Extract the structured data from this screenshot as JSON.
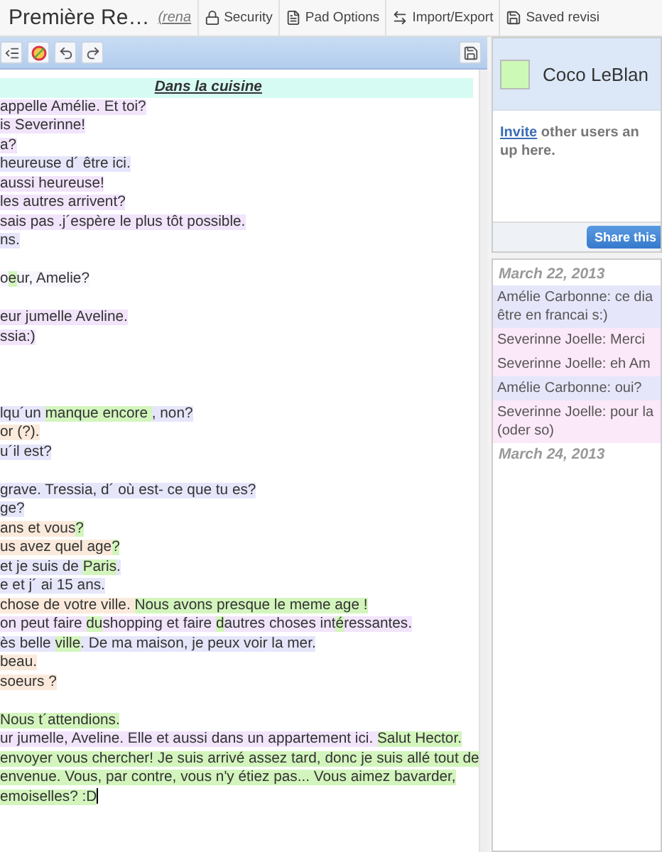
{
  "header": {
    "title": "Première Re…",
    "rename_link": "(rena"
  },
  "top_buttons": [
    {
      "kind": "lock",
      "label": "Security"
    },
    {
      "kind": "file",
      "label": "Pad Options"
    },
    {
      "kind": "arrows",
      "label": "Import/Export"
    },
    {
      "kind": "save",
      "label": "Saved revisi"
    }
  ],
  "editor": {
    "heading": "Dans la cuisine",
    "lines": [
      {
        "kind": "text",
        "segments": [
          {
            "t": "appelle Amélie. Et toi?",
            "color": "#f1e4fb"
          }
        ]
      },
      {
        "kind": "text",
        "segments": [
          {
            "t": "is Severinne!",
            "color": "#f1e4fb"
          }
        ]
      },
      {
        "kind": "text",
        "segments": [
          {
            "t": "a?",
            "color": "#f1e4fb"
          }
        ]
      },
      {
        "kind": "text",
        "segments": [
          {
            "t": "heureuse d´ être ici.",
            "color": "#e6e6fb"
          }
        ]
      },
      {
        "kind": "text",
        "segments": [
          {
            "t": "aussi heureuse!",
            "color": "#f1e4fb"
          }
        ]
      },
      {
        "kind": "text",
        "segments": [
          {
            "t": "les autres arrivent?",
            "color": "#f1e4fb"
          }
        ]
      },
      {
        "kind": "text",
        "segments": [
          {
            "t": "sais pas .j´espère le plus tôt possible.",
            "color": "#f1e4fb"
          }
        ]
      },
      {
        "kind": "text",
        "segments": [
          {
            "t": "ns.",
            "color": "#e6e6fb"
          }
        ]
      },
      {
        "kind": "blank"
      },
      {
        "kind": "text",
        "segments": [
          {
            "t": "o",
            "color": "#f6f6fd"
          },
          {
            "t": "e",
            "color": "#d3f5bd"
          },
          {
            "t": "ur, Amelie?",
            "color": "#f6f6fd"
          }
        ]
      },
      {
        "kind": "blank"
      },
      {
        "kind": "text",
        "segments": [
          {
            "t": "eur jumelle Aveline.",
            "color": "#f1e4fb"
          }
        ]
      },
      {
        "kind": "text",
        "segments": [
          {
            "t": "ssia:)",
            "color": "#f1e4fb"
          }
        ]
      },
      {
        "kind": "blank"
      },
      {
        "kind": "blank"
      },
      {
        "kind": "blank"
      },
      {
        "kind": "text",
        "segments": [
          {
            "t": "lqu´un ",
            "color": "#e6e6fb"
          },
          {
            "t": "manque encore ",
            "color": "#d3f5bd"
          },
          {
            "t": ", non?",
            "color": "#e6e6fb"
          }
        ]
      },
      {
        "kind": "text",
        "segments": [
          {
            "t": "or (?).",
            "color": "#fbeadb"
          }
        ]
      },
      {
        "kind": "text",
        "segments": [
          {
            "t": "u´il est?",
            "color": "#e6e6fb"
          }
        ]
      },
      {
        "kind": "blank"
      },
      {
        "kind": "text",
        "segments": [
          {
            "t": "grave. Tressia, d´ où est- ce que tu es?",
            "color": "#e6e6fb"
          }
        ]
      },
      {
        "kind": "text",
        "segments": [
          {
            "t": "ge?",
            "color": "#e6e6fb"
          }
        ]
      },
      {
        "kind": "text",
        "segments": [
          {
            "t": "ans et vous",
            "color": "#fbeadb"
          },
          {
            "t": "?",
            "color": "#d3f5bd"
          }
        ]
      },
      {
        "kind": "text",
        "segments": [
          {
            "t": "us avez quel age",
            "color": "#fbeadb"
          },
          {
            "t": "?",
            "color": "#d3f5bd"
          }
        ]
      },
      {
        "kind": "text",
        "segments": [
          {
            "t": "et je suis de ",
            "color": "#e6e6fb"
          },
          {
            "t": "Paris",
            "color": "#d3f5bd"
          },
          {
            "t": ".",
            "color": "#e6e6fb"
          }
        ]
      },
      {
        "kind": "text",
        "segments": [
          {
            "t": "e et j´ ai 15 ans.",
            "color": "#e6e6fb"
          }
        ]
      },
      {
        "kind": "text",
        "segments": [
          {
            "t": "chose de votre ville. ",
            "color": "#fbeadb"
          },
          {
            "t": "Nous avons presque le meme age !",
            "color": "#d3f5bd"
          }
        ]
      },
      {
        "kind": "text",
        "segments": [
          {
            "t": "on peut faire ",
            "color": "#f1e4fb"
          },
          {
            "t": "du",
            "color": "#d3f5bd"
          },
          {
            "t": "shopping et faire ",
            "color": "#f1e4fb"
          },
          {
            "t": "d",
            "color": "#d3f5bd"
          },
          {
            "t": "autres choses int",
            "color": "#f1e4fb"
          },
          {
            "t": "é",
            "color": "#d3f5bd"
          },
          {
            "t": "ressantes.",
            "color": "#f1e4fb"
          }
        ]
      },
      {
        "kind": "text",
        "segments": [
          {
            "t": "ès belle ",
            "color": "#e6e6fb"
          },
          {
            "t": "ville",
            "color": "#d3f5bd"
          },
          {
            "t": ". De ma maison, je peux voir la mer.",
            "color": "#e6e6fb"
          }
        ]
      },
      {
        "kind": "text",
        "segments": [
          {
            "t": "beau.",
            "color": "#fbeadb"
          }
        ]
      },
      {
        "kind": "text",
        "segments": [
          {
            "t": "soeurs ?",
            "color": "#fbeadb"
          }
        ]
      },
      {
        "kind": "blank"
      },
      {
        "kind": "text",
        "segments": [
          {
            "t": "Nous t´attendions.",
            "color": "#d3f5bd"
          }
        ]
      },
      {
        "kind": "text",
        "segments": [
          {
            "t": "ur jumelle, Aveline. Elle et aussi dans un appartement ici. ",
            "color": "#f1e4fb"
          },
          {
            "t": "Salut Hector.",
            "color": "#d3f5bd"
          }
        ]
      },
      {
        "kind": "text",
        "segments": [
          {
            "t": "envoyer vous chercher! Je suis arrivé assez tard, donc je suis allé tout de",
            "color": "#d3f5bd"
          }
        ]
      },
      {
        "kind": "text",
        "segments": [
          {
            "t": "envenue. Vous, par contre, vous n'y étiez pas... Vous aimez bavarder,",
            "color": "#d3f5bd"
          }
        ]
      },
      {
        "kind": "text",
        "segments": [
          {
            "t": "emoiselles? :D",
            "color": "#d3f5bd"
          }
        ]
      }
    ]
  },
  "user": {
    "name": "Coco LeBlan",
    "color": "#ccf9b5"
  },
  "invite": {
    "link": "Invite",
    "line1": "other users an",
    "line2": "up here."
  },
  "share_button": "Share this",
  "chat": [
    {
      "kind": "date",
      "text": "March 22, 2013"
    },
    {
      "kind": "message",
      "color": "#e6e6fb",
      "lines": [
        "Amélie Carbonne: ce dia",
        "être en francai s:)"
      ]
    },
    {
      "kind": "message",
      "color": "#fbe8f8",
      "lines": [
        "Severinne Joelle: Merci"
      ]
    },
    {
      "kind": "message",
      "color": "#fbe8f8",
      "lines": [
        "Severinne Joelle: eh Am"
      ]
    },
    {
      "kind": "message",
      "color": "#e6e6fb",
      "lines": [
        "Amélie Carbonne: oui?"
      ]
    },
    {
      "kind": "message",
      "color": "#fbe8f8",
      "lines": [
        "Severinne Joelle: pour la",
        "(oder so)"
      ]
    },
    {
      "kind": "date",
      "text": "March 24, 2013"
    }
  ]
}
